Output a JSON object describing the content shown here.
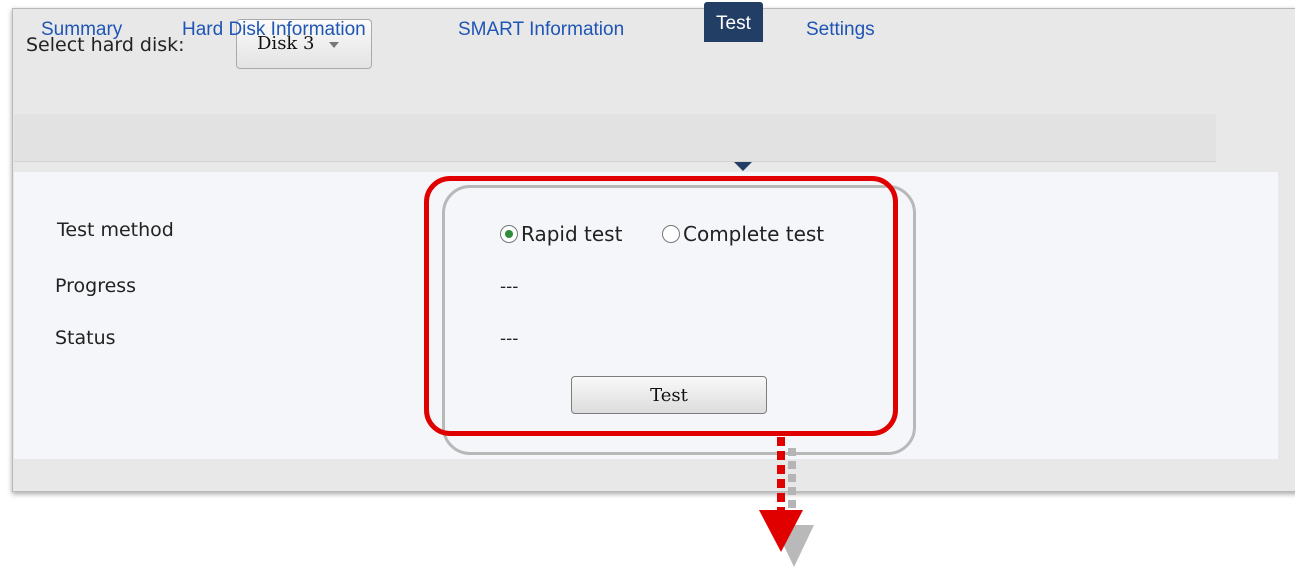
{
  "header": {
    "select_label": "Select hard disk:",
    "selected_disk": "Disk 3"
  },
  "tabs": [
    {
      "label": "Summary",
      "active": false
    },
    {
      "label": "Hard Disk Information",
      "active": false
    },
    {
      "label": "SMART Information",
      "active": false
    },
    {
      "label": "Test",
      "active": true
    },
    {
      "label": "Settings",
      "active": false
    }
  ],
  "test": {
    "method_label": "Test method",
    "progress_label": "Progress",
    "status_label": "Status",
    "options": [
      {
        "label": "Rapid test",
        "selected": true
      },
      {
        "label": "Complete test",
        "selected": false
      }
    ],
    "progress_value": "---",
    "status_value": "---",
    "button_label": "Test"
  },
  "colors": {
    "tab_link": "#1f55b4",
    "active_tab_bg": "#233e64",
    "highlight": "#e10000",
    "radio_selected": "#2f8c3a"
  }
}
